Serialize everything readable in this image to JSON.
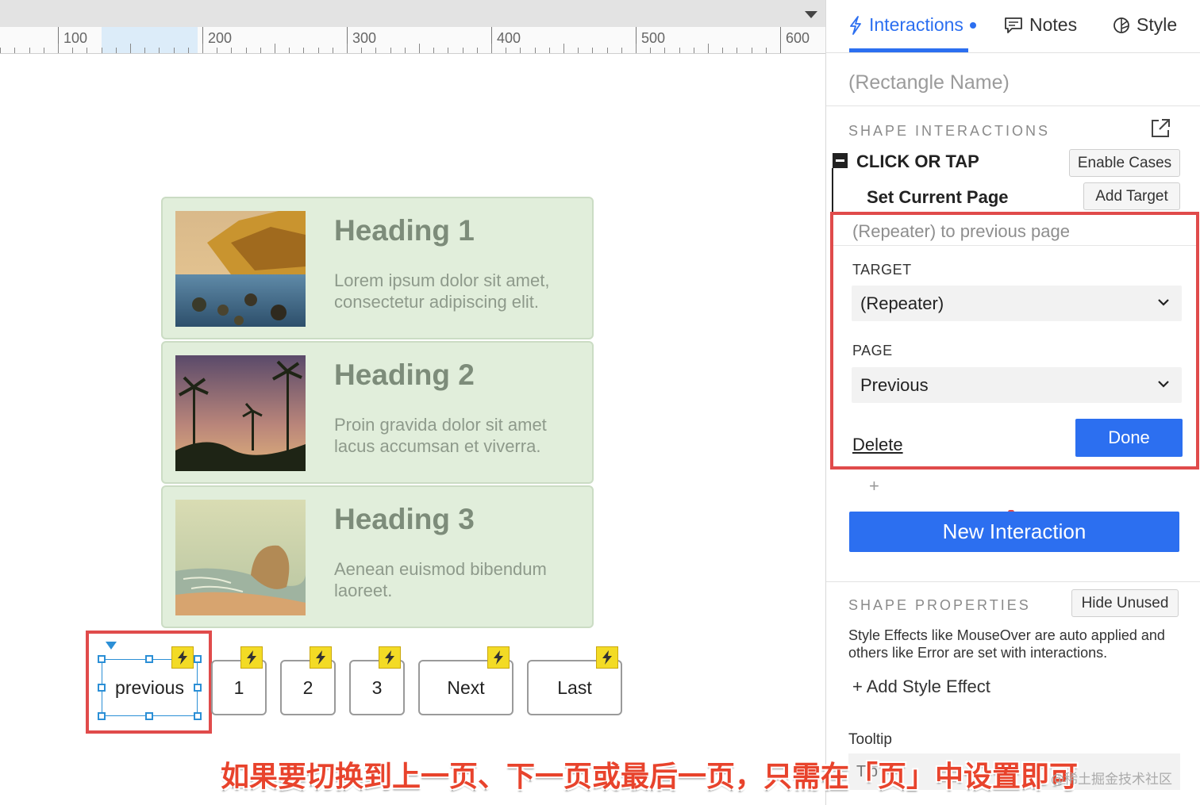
{
  "ruler": {
    "labels": [
      "100",
      "200",
      "300",
      "400",
      "500",
      "600"
    ]
  },
  "cards": [
    {
      "heading": "Heading 1",
      "body": "Lorem ipsum dolor sit amet, consectetur adipiscing elit."
    },
    {
      "heading": "Heading 2",
      "body": "Proin gravida dolor sit amet lacus accumsan et viverra."
    },
    {
      "heading": "Heading 3",
      "body": "Aenean euismod bibendum laoreet."
    }
  ],
  "pagination": {
    "previous": "previous",
    "page1": "1",
    "page2": "2",
    "page3": "3",
    "next": "Next",
    "last": "Last"
  },
  "caption": "如果要切换到上一页、下一页或最后一页，只需在「页」中设置即可",
  "watermark": "@稀土掘金技术社区",
  "panel": {
    "tabs": {
      "interactions": "Interactions",
      "notes": "Notes",
      "style": "Style"
    },
    "rectangle_name": "(Rectangle Name)",
    "shape_interactions": "SHAPE INTERACTIONS",
    "event_title": "CLICK OR TAP",
    "enable_cases": "Enable Cases",
    "action_title": "Set Current Page",
    "add_target": "Add Target",
    "action": {
      "summary": "(Repeater) to previous page",
      "target_label": "TARGET",
      "target_value": "(Repeater)",
      "page_label": "PAGE",
      "page_value": "Previous",
      "delete": "Delete",
      "done": "Done"
    },
    "new_interaction": "New Interaction",
    "shape_properties": "SHAPE PROPERTIES",
    "hide_unused": "Hide Unused",
    "properties_desc": "Style Effects like MouseOver are auto applied and others like Error are set with interactions.",
    "add_style_effect": "+ Add Style Effect",
    "tooltip_label": "Tooltip",
    "tooltip_placeholder": "Tip"
  },
  "colors": {
    "accent": "#2c6ff0",
    "highlight_red": "#e04b4b",
    "card_bg": "#e1eedb",
    "flag_yellow": "#f3db25",
    "selection_blue": "#2b8fd6"
  }
}
